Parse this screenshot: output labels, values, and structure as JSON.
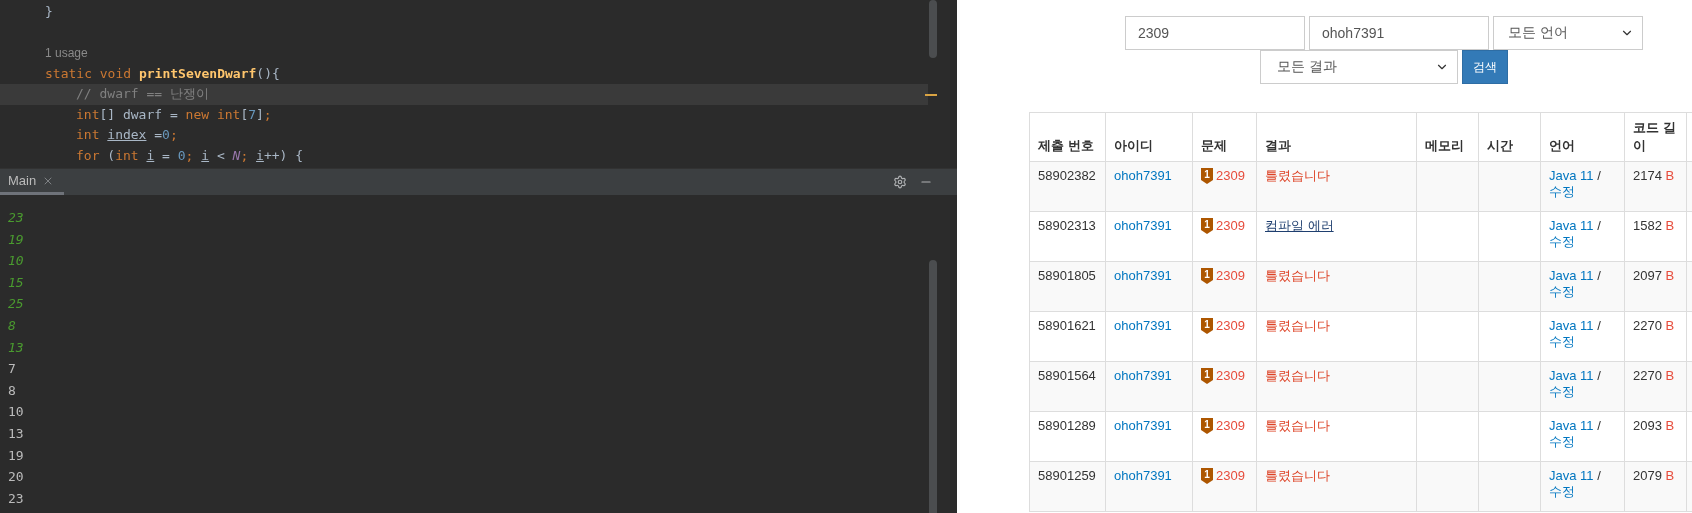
{
  "editor": {
    "lines": [
      {
        "kind": "code",
        "current": false,
        "tokens": [
          {
            "kind": "plain",
            "s": "}"
          }
        ]
      },
      {
        "kind": "blank"
      },
      {
        "kind": "hint",
        "current": false,
        "text": "1 usage"
      },
      {
        "kind": "code",
        "current": false,
        "tokens": [
          {
            "kind": "keyword",
            "s": "static void "
          },
          {
            "kind": "function",
            "s": "printSevenDwarf"
          },
          {
            "kind": "plain",
            "s": "(){"
          }
        ],
        "children": [
          {
            "kind": "code",
            "current": true,
            "tokens": [
              {
                "kind": "comment",
                "s": "// dwarf == 난쟁이"
              }
            ]
          },
          {
            "kind": "code",
            "current": false,
            "tokens": [
              {
                "kind": "keyword",
                "s": "int"
              },
              {
                "kind": "plain",
                "s": "[] dwarf = "
              },
              {
                "kind": "keyword",
                "s": "new int"
              },
              {
                "kind": "plain",
                "s": "["
              },
              {
                "kind": "number",
                "s": "7"
              },
              {
                "kind": "plain",
                "s": "]"
              },
              {
                "kind": "keyword",
                "s": ";"
              }
            ]
          },
          {
            "kind": "code",
            "current": false,
            "tokens": [
              {
                "kind": "keyword",
                "s": "int "
              },
              {
                "kind": "variable",
                "s": "index"
              },
              {
                "kind": "plain",
                "s": " ="
              },
              {
                "kind": "number",
                "s": "0"
              },
              {
                "kind": "keyword",
                "s": ";"
              }
            ]
          },
          {
            "kind": "code",
            "current": false,
            "tokens": [
              {
                "kind": "keyword",
                "s": "for "
              },
              {
                "kind": "plain",
                "s": "("
              },
              {
                "kind": "keyword",
                "s": "int "
              },
              {
                "kind": "variable",
                "s": "i"
              },
              {
                "kind": "plain",
                "s": " = "
              },
              {
                "kind": "number",
                "s": "0"
              },
              {
                "kind": "keyword",
                "s": "; "
              },
              {
                "kind": "variable",
                "s": "i"
              },
              {
                "kind": "plain",
                "s": " < "
              },
              {
                "kind": "constant",
                "s": "N"
              },
              {
                "kind": "keyword",
                "s": "; "
              },
              {
                "kind": "variable",
                "s": "i"
              },
              {
                "kind": "plain",
                "s": "++) {"
              }
            ]
          }
        ]
      }
    ]
  },
  "run_panel": {
    "tabs": [
      {
        "label": "Main",
        "selected": true
      }
    ],
    "output": [
      {
        "kind": "input",
        "text": "23"
      },
      {
        "kind": "input",
        "text": "19"
      },
      {
        "kind": "input",
        "text": "10"
      },
      {
        "kind": "input",
        "text": "15"
      },
      {
        "kind": "input",
        "text": "25"
      },
      {
        "kind": "input",
        "text": "8"
      },
      {
        "kind": "input",
        "text": "13"
      },
      {
        "kind": "output",
        "text": "7"
      },
      {
        "kind": "output",
        "text": "8"
      },
      {
        "kind": "output",
        "text": "10"
      },
      {
        "kind": "output",
        "text": "13"
      },
      {
        "kind": "output",
        "text": "19"
      },
      {
        "kind": "output",
        "text": "20"
      },
      {
        "kind": "output",
        "text": "23"
      }
    ]
  },
  "search_form": {
    "problem_id": "2309",
    "user_id": "ohoh7391",
    "language": "모든 언어",
    "result": "모든 결과",
    "button": "검색"
  },
  "table": {
    "columns": [
      "제출 번호",
      "아이디",
      "문제",
      "결과",
      "메모리",
      "시간",
      "언어",
      "코드 길이"
    ],
    "rows": [
      {
        "id": "58902382",
        "user": "ohoh7391",
        "tier": "1",
        "problem": "2309",
        "result": {
          "kind": "wrong",
          "text": "틀렸습니다"
        },
        "language": "Java 11",
        "separator": "/",
        "edit": "수정",
        "length": "2174",
        "unit": "B"
      },
      {
        "id": "58902313",
        "user": "ohoh7391",
        "tier": "1",
        "problem": "2309",
        "result": {
          "kind": "compile_error",
          "text": "컴파일 에러"
        },
        "language": "Java 11",
        "separator": "/",
        "edit": "수정",
        "length": "1582",
        "unit": "B"
      },
      {
        "id": "58901805",
        "user": "ohoh7391",
        "tier": "1",
        "problem": "2309",
        "result": {
          "kind": "wrong",
          "text": "틀렸습니다"
        },
        "language": "Java 11",
        "separator": "/",
        "edit": "수정",
        "length": "2097",
        "unit": "B"
      },
      {
        "id": "58901621",
        "user": "ohoh7391",
        "tier": "1",
        "problem": "2309",
        "result": {
          "kind": "wrong",
          "text": "틀렸습니다"
        },
        "language": "Java 11",
        "separator": "/",
        "edit": "수정",
        "length": "2270",
        "unit": "B"
      },
      {
        "id": "58901564",
        "user": "ohoh7391",
        "tier": "1",
        "problem": "2309",
        "result": {
          "kind": "wrong",
          "text": "틀렸습니다"
        },
        "language": "Java 11",
        "separator": "/",
        "edit": "수정",
        "length": "2270",
        "unit": "B"
      },
      {
        "id": "58901289",
        "user": "ohoh7391",
        "tier": "1",
        "problem": "2309",
        "result": {
          "kind": "wrong",
          "text": "틀렸습니다"
        },
        "language": "Java 11",
        "separator": "/",
        "edit": "수정",
        "length": "2093",
        "unit": "B"
      },
      {
        "id": "58901259",
        "user": "ohoh7391",
        "tier": "1",
        "problem": "2309",
        "result": {
          "kind": "wrong",
          "text": "틀렸습니다"
        },
        "language": "Java 11",
        "separator": "/",
        "edit": "수정",
        "length": "2079",
        "unit": "B"
      }
    ]
  }
}
